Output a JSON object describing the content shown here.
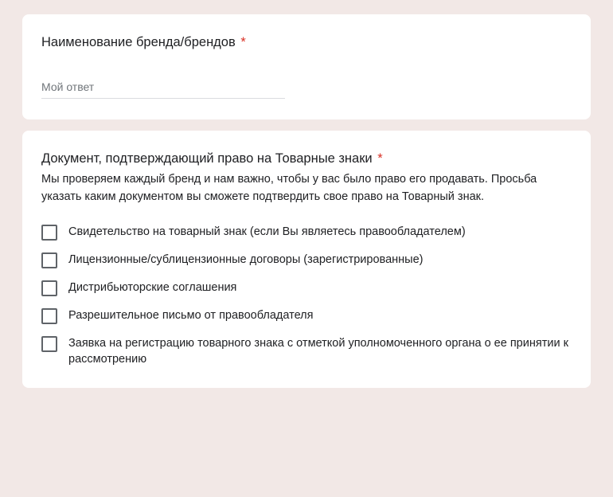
{
  "q1": {
    "title": "Наименование бренда/брендов",
    "required_marker": "*",
    "placeholder": "Мой ответ"
  },
  "q2": {
    "title": "Документ, подтверждающий право на Товарные знаки",
    "required_marker": "*",
    "description": "Мы проверяем каждый бренд и нам важно, чтобы у вас было право его продавать. Просьба указать каким документом вы сможете подтвердить свое право на Товарный знак.",
    "options": [
      "Свидетельство на товарный знак (если Вы являетесь правообладателем)",
      "Лицензионные/сублицензионные договоры (зарегистрированные)",
      "Дистрибьюторские соглашения",
      "Разрешительное письмо от правообладателя",
      "Заявка на регистрацию товарного знака с отметкой уполномоченного органа о ее принятии к рассмотрению"
    ]
  }
}
